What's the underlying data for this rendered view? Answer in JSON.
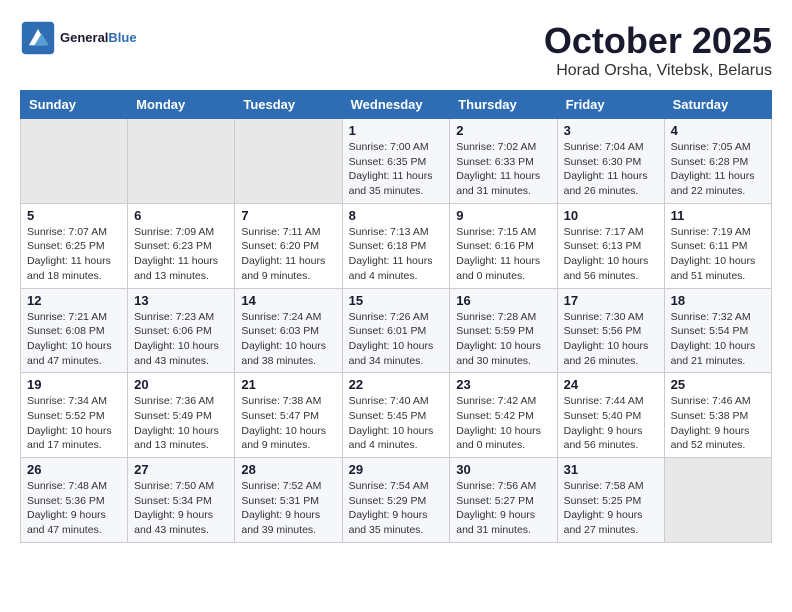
{
  "header": {
    "logo_general": "General",
    "logo_blue": "Blue",
    "month_title": "October 2025",
    "location": "Horad Orsha, Vitebsk, Belarus"
  },
  "weekdays": [
    "Sunday",
    "Monday",
    "Tuesday",
    "Wednesday",
    "Thursday",
    "Friday",
    "Saturday"
  ],
  "weeks": [
    [
      {
        "day": "",
        "info": ""
      },
      {
        "day": "",
        "info": ""
      },
      {
        "day": "",
        "info": ""
      },
      {
        "day": "1",
        "info": "Sunrise: 7:00 AM\nSunset: 6:35 PM\nDaylight: 11 hours\nand 35 minutes."
      },
      {
        "day": "2",
        "info": "Sunrise: 7:02 AM\nSunset: 6:33 PM\nDaylight: 11 hours\nand 31 minutes."
      },
      {
        "day": "3",
        "info": "Sunrise: 7:04 AM\nSunset: 6:30 PM\nDaylight: 11 hours\nand 26 minutes."
      },
      {
        "day": "4",
        "info": "Sunrise: 7:05 AM\nSunset: 6:28 PM\nDaylight: 11 hours\nand 22 minutes."
      }
    ],
    [
      {
        "day": "5",
        "info": "Sunrise: 7:07 AM\nSunset: 6:25 PM\nDaylight: 11 hours\nand 18 minutes."
      },
      {
        "day": "6",
        "info": "Sunrise: 7:09 AM\nSunset: 6:23 PM\nDaylight: 11 hours\nand 13 minutes."
      },
      {
        "day": "7",
        "info": "Sunrise: 7:11 AM\nSunset: 6:20 PM\nDaylight: 11 hours\nand 9 minutes."
      },
      {
        "day": "8",
        "info": "Sunrise: 7:13 AM\nSunset: 6:18 PM\nDaylight: 11 hours\nand 4 minutes."
      },
      {
        "day": "9",
        "info": "Sunrise: 7:15 AM\nSunset: 6:16 PM\nDaylight: 11 hours\nand 0 minutes."
      },
      {
        "day": "10",
        "info": "Sunrise: 7:17 AM\nSunset: 6:13 PM\nDaylight: 10 hours\nand 56 minutes."
      },
      {
        "day": "11",
        "info": "Sunrise: 7:19 AM\nSunset: 6:11 PM\nDaylight: 10 hours\nand 51 minutes."
      }
    ],
    [
      {
        "day": "12",
        "info": "Sunrise: 7:21 AM\nSunset: 6:08 PM\nDaylight: 10 hours\nand 47 minutes."
      },
      {
        "day": "13",
        "info": "Sunrise: 7:23 AM\nSunset: 6:06 PM\nDaylight: 10 hours\nand 43 minutes."
      },
      {
        "day": "14",
        "info": "Sunrise: 7:24 AM\nSunset: 6:03 PM\nDaylight: 10 hours\nand 38 minutes."
      },
      {
        "day": "15",
        "info": "Sunrise: 7:26 AM\nSunset: 6:01 PM\nDaylight: 10 hours\nand 34 minutes."
      },
      {
        "day": "16",
        "info": "Sunrise: 7:28 AM\nSunset: 5:59 PM\nDaylight: 10 hours\nand 30 minutes."
      },
      {
        "day": "17",
        "info": "Sunrise: 7:30 AM\nSunset: 5:56 PM\nDaylight: 10 hours\nand 26 minutes."
      },
      {
        "day": "18",
        "info": "Sunrise: 7:32 AM\nSunset: 5:54 PM\nDaylight: 10 hours\nand 21 minutes."
      }
    ],
    [
      {
        "day": "19",
        "info": "Sunrise: 7:34 AM\nSunset: 5:52 PM\nDaylight: 10 hours\nand 17 minutes."
      },
      {
        "day": "20",
        "info": "Sunrise: 7:36 AM\nSunset: 5:49 PM\nDaylight: 10 hours\nand 13 minutes."
      },
      {
        "day": "21",
        "info": "Sunrise: 7:38 AM\nSunset: 5:47 PM\nDaylight: 10 hours\nand 9 minutes."
      },
      {
        "day": "22",
        "info": "Sunrise: 7:40 AM\nSunset: 5:45 PM\nDaylight: 10 hours\nand 4 minutes."
      },
      {
        "day": "23",
        "info": "Sunrise: 7:42 AM\nSunset: 5:42 PM\nDaylight: 10 hours\nand 0 minutes."
      },
      {
        "day": "24",
        "info": "Sunrise: 7:44 AM\nSunset: 5:40 PM\nDaylight: 9 hours\nand 56 minutes."
      },
      {
        "day": "25",
        "info": "Sunrise: 7:46 AM\nSunset: 5:38 PM\nDaylight: 9 hours\nand 52 minutes."
      }
    ],
    [
      {
        "day": "26",
        "info": "Sunrise: 7:48 AM\nSunset: 5:36 PM\nDaylight: 9 hours\nand 47 minutes."
      },
      {
        "day": "27",
        "info": "Sunrise: 7:50 AM\nSunset: 5:34 PM\nDaylight: 9 hours\nand 43 minutes."
      },
      {
        "day": "28",
        "info": "Sunrise: 7:52 AM\nSunset: 5:31 PM\nDaylight: 9 hours\nand 39 minutes."
      },
      {
        "day": "29",
        "info": "Sunrise: 7:54 AM\nSunset: 5:29 PM\nDaylight: 9 hours\nand 35 minutes."
      },
      {
        "day": "30",
        "info": "Sunrise: 7:56 AM\nSunset: 5:27 PM\nDaylight: 9 hours\nand 31 minutes."
      },
      {
        "day": "31",
        "info": "Sunrise: 7:58 AM\nSunset: 5:25 PM\nDaylight: 9 hours\nand 27 minutes."
      },
      {
        "day": "",
        "info": ""
      }
    ]
  ]
}
